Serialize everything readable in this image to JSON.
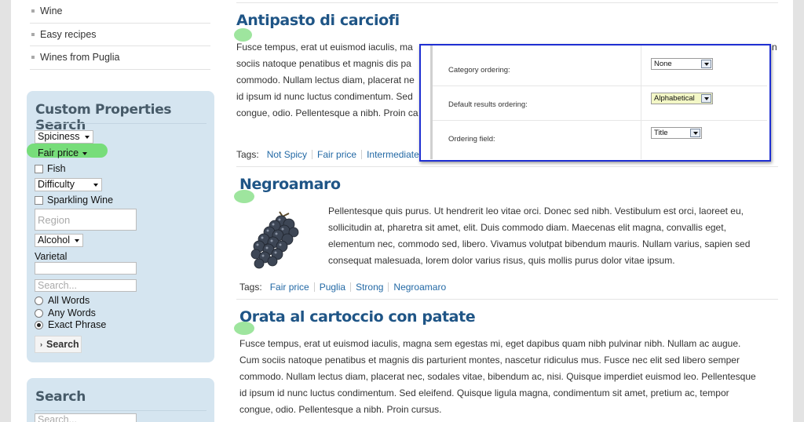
{
  "sidebar": {
    "categories": [
      "Wine",
      "Easy recipes",
      "Wines from Puglia"
    ],
    "custom_search": {
      "title": "Custom Properties Search",
      "spiciness": "Spiciness",
      "fair_price": "Fair price",
      "fish": "Fish",
      "difficulty": "Difficulty",
      "sparkling": "Sparkling Wine",
      "region_placeholder": "Region",
      "alcohol": "Alcohol",
      "varietal": "Varietal",
      "search_placeholder": "Search...",
      "all_words": "All Words",
      "any_words": "Any Words",
      "exact_phrase": "Exact Phrase",
      "search_button": "Search"
    },
    "search_box": {
      "title": "Search",
      "placeholder": "Search..."
    }
  },
  "articles": [
    {
      "title": "Antipasto di carciofi",
      "lines": [
        "Fusce tempus, erat ut euismod iaculis, ma",
        "sociis natoque penatibus et magnis dis pa",
        "commodo. Nullam lectus diam, placerat ne",
        "id ipsum id nunc luctus condimentum. Sed",
        "congue, odio. Pellentesque a nibh. Proin ca"
      ],
      "right_fragment": "n",
      "tags_label": "Tags:",
      "tags": [
        "Not Spicy",
        "Fair price",
        "Intermediate"
      ]
    },
    {
      "title": "Negroamaro",
      "lines": [
        "Pellentesque quis purus. Ut hendrerit leo vitae orci. Donec sed nibh. Vestibulum est orci, laoreet eu,",
        "sollicitudin at, pharetra sit amet, elit. Duis commodo diam. Maecenas elit magna, convallis eget,",
        "elementum nec, commodo sed, libero. Vivamus volutpat bibendum mauris. Nullam varius, sapien sed",
        "consequat malesuada, lorem dolor varius risus, quis mollis purus dolor vitae ipsum."
      ],
      "tags_label": "Tags:",
      "tags": [
        "Fair price",
        "Puglia",
        "Strong",
        "Negroamaro"
      ]
    },
    {
      "title": "Orata al cartoccio con patate",
      "lines": [
        "Fusce tempus, erat ut euismod iaculis, magna sem egestas mi, eget dapibus quam nibh pulvinar nibh. Nullam ac augue.",
        "Cum sociis natoque penatibus et magnis dis parturient montes, nascetur ridiculus mus. Fusce nec elit sed libero semper",
        "commodo. Nullam lectus diam, placerat nec, sodales vitae, bibendum ac, nisi. Quisque imperdiet euismod leo. Pellentesque",
        "id ipsum id nunc luctus condimentum. Sed eleifend. Quisque ligula magna, condimentum sit amet, pretium ac, tempor",
        "congue, odio. Pellentesque a nibh. Proin cursus."
      ]
    }
  ],
  "overlay": {
    "rows": [
      {
        "label": "Category ordering:",
        "value": "None"
      },
      {
        "label": "Default results ordering:",
        "value": "Alphabetical"
      },
      {
        "label": "Ordering field:",
        "value": "Title"
      }
    ]
  },
  "colors": {
    "title_blue": "#1f5586",
    "link_blue": "#2369a5",
    "sidebar_bg": "#d5e5f0",
    "highlight_green": "#6ddc6d",
    "overlay_border": "#1f2fd2"
  }
}
